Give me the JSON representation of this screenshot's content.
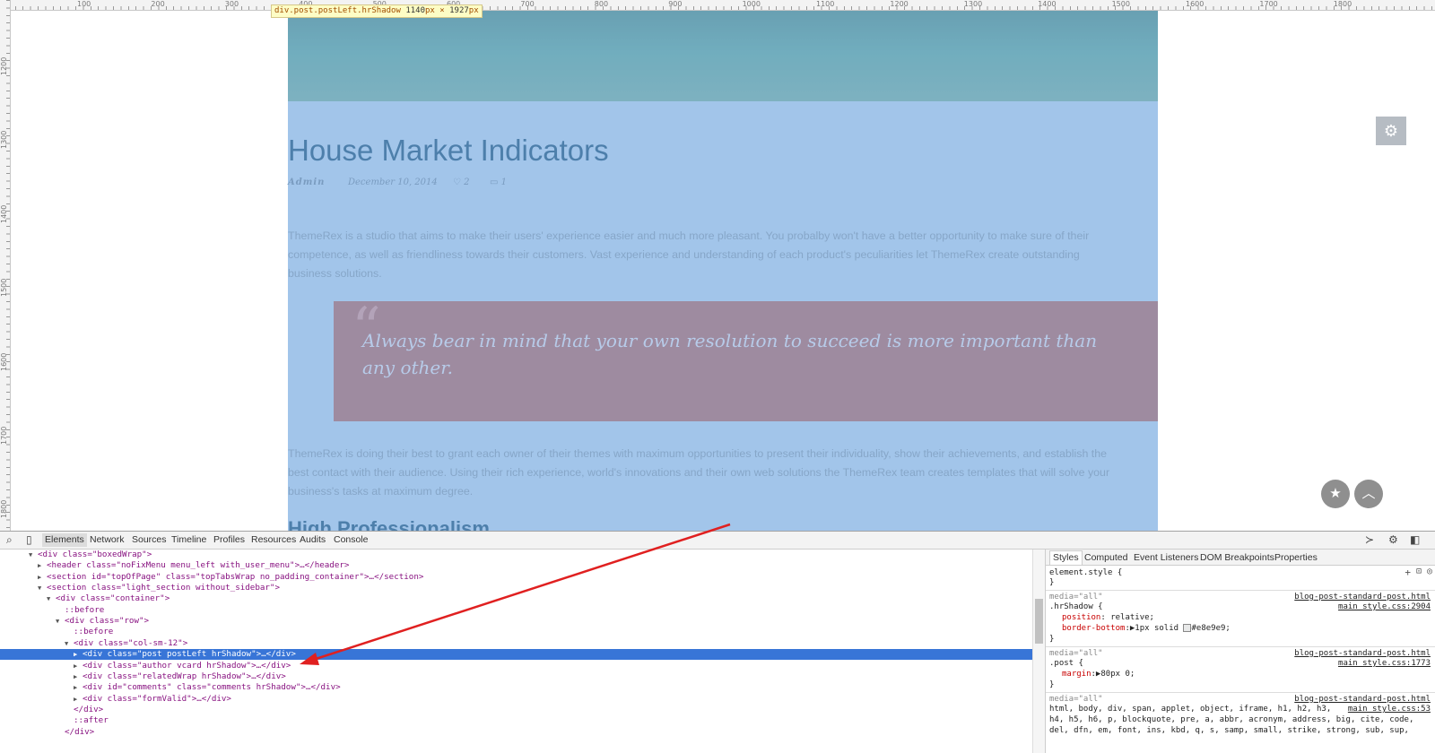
{
  "ruler": {
    "top_ticks": [
      "100",
      "200",
      "300",
      "400",
      "500",
      "600",
      "700",
      "800",
      "900",
      "1000",
      "1100",
      "1200",
      "1300",
      "1400",
      "1500",
      "1600",
      "1700",
      "1800"
    ],
    "left_ticks": [
      "1200",
      "1300",
      "1400",
      "1500",
      "1600",
      "1700",
      "1800"
    ]
  },
  "tooltip": {
    "selector": "div.post.postLeft.hrShadow",
    "width": "1140",
    "height": "1927",
    "unit": "px",
    "times": "×"
  },
  "post": {
    "title": "House Market Indicators",
    "author": "Admin",
    "date": "December 10, 2014",
    "likes": "2",
    "comments": "1",
    "paragraph1": "ThemeRex is a studio that aims to make their users' experience easier and much more pleasant. You probalby won't have a better opportunity to make sure of their competence, as well as friendliness towards their customers. Vast experience and understanding of each product's peculiarities let ThemeRex create outstanding business solutions.",
    "quote_mark": "“",
    "quote": "Always bear in mind that your own resolution to succeed is more important than any other.",
    "paragraph2": "ThemeRex is doing their best to grant each owner of their themes with maximum opportunities to present their individuality, show their achievements, and establish the best contact with their audience. Using their rich experience, world's innovations and their own web solutions the ThemeRex team creates templates that will solve your business's tasks at maximum degree.",
    "subheading": "High Professionalism"
  },
  "devtools": {
    "tabs": [
      "Elements",
      "Network",
      "Sources",
      "Timeline",
      "Profiles",
      "Resources",
      "Audits",
      "Console"
    ],
    "active_tab": "Elements",
    "dom_lines": [
      {
        "text": "<div class=\"boxedWrap\">"
      },
      {
        "text": "<header class=\"noFixMenu menu_left with_user_menu\">…</header>"
      },
      {
        "text": "<section id=\"topOfPage\" class=\"topTabsWrap no_padding_container\">…</section>"
      },
      {
        "text": "<section class=\"light_section without_sidebar\">"
      },
      {
        "text": "<div class=\"container\">"
      },
      {
        "text": "::before"
      },
      {
        "text": "<div class=\"row\">"
      },
      {
        "text": "::before"
      },
      {
        "text": "<div class=\"col-sm-12\">"
      },
      {
        "text": "<div class=\"post postLeft hrShadow\">…</div>"
      },
      {
        "text": "<div class=\"author vcard hrShadow\">…</div>"
      },
      {
        "text": "<div class=\"relatedWrap hrShadow\">…</div>"
      },
      {
        "text": "<div id=\"comments\" class=\"comments hrShadow\">…</div>"
      },
      {
        "text": "<div class=\"formValid\">…</div>"
      },
      {
        "text": "</div>"
      },
      {
        "text": "::after"
      },
      {
        "text": "</div>"
      }
    ],
    "styles_tabs": [
      "Styles",
      "Computed",
      "Event Listeners",
      "DOM Breakpoints",
      "Properties"
    ],
    "styles": {
      "element_style": "element.style {",
      "close_brace": "}",
      "rule1": {
        "media": "media=\"all\"",
        "selector": ".hrShadow {",
        "file": "blog-post-standard-post.html",
        "src": "main_style.css:2904",
        "p1_name": "position",
        "p1_value": " relative;",
        "p2_name": "border-bottom",
        "p2_value": "1px solid ",
        "p2_color": "#e8e9e9;"
      },
      "rule2": {
        "media": "media=\"all\"",
        "selector": ".post {",
        "file": "blog-post-standard-post.html",
        "src": "main_style.css:1773",
        "p1_name": "margin",
        "p1_value": "80px 0;"
      },
      "rule3": {
        "media": "media=\"all\"",
        "file": "blog-post-standard-post.html",
        "src": "main_style.css:53",
        "line1": "html, body, div, span, applet, object, iframe, h1, h2, h3,",
        "line2": "h4, h5, h6, p, blockquote, pre, a, abbr, acronym, address, big, cite, code,",
        "line3": "del, dfn, em, font, ins, kbd, q, s, samp, small, strike, strong, sub, sup,"
      }
    }
  },
  "colors": {
    "highlight": "#a2c5ea",
    "selection": "#3875d7",
    "arrow": "#e02020"
  }
}
